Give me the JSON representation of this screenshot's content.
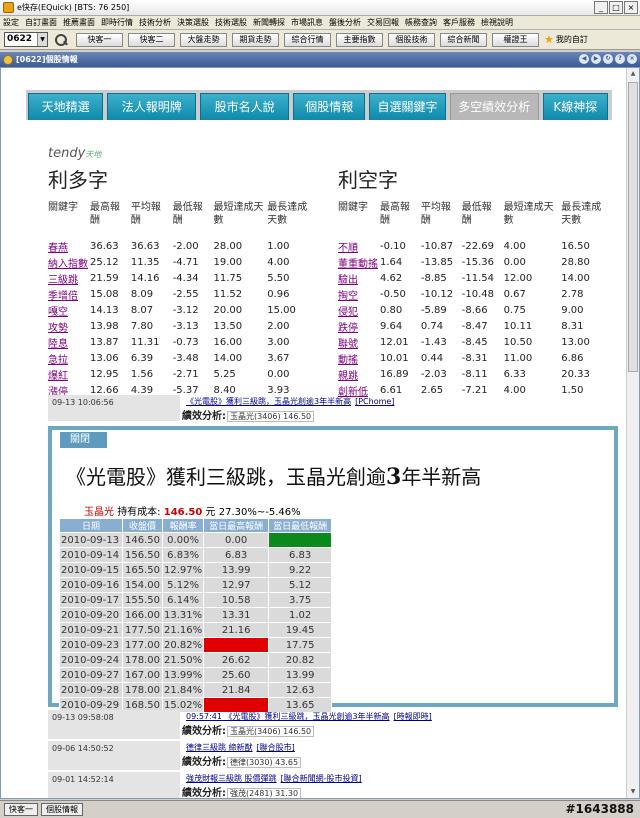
{
  "window": {
    "title": "e快存(EQuick)  [BTS: 76 250]"
  },
  "menu": [
    "設定",
    "自訂畫面",
    "推薦畫面",
    "即時行情",
    "技術分析",
    "決策選股",
    "技術選股",
    "新聞轉探",
    "市場訊息",
    "盤後分析",
    "交易回報",
    "帳務查詢",
    "客戶服務",
    "檢視說明"
  ],
  "toolbar": {
    "code": "0622",
    "buttons": [
      "快客一",
      "快客二",
      "大盤走勢",
      "期貨走勢",
      "綜合行情",
      "主要指數",
      "個股技術",
      "綜合新聞",
      "權證王"
    ],
    "favorite": "我的自訂"
  },
  "panel": {
    "title": "[0622]個股情報"
  },
  "tabs": [
    {
      "label": "天地精選",
      "active": false
    },
    {
      "label": "法人報明牌",
      "active": false
    },
    {
      "label": "股市名人說",
      "active": false
    },
    {
      "label": "個股情報",
      "active": false
    },
    {
      "label": "自選關鍵字",
      "active": false
    },
    {
      "label": "多空績效分析",
      "active": true
    },
    {
      "label": "K線神探",
      "active": false
    }
  ],
  "logo": {
    "brand": "tendy",
    "sub": "天地"
  },
  "bull": {
    "heading": "利多字",
    "headers": [
      "關鍵字",
      "最高報酬",
      "平均報酬",
      "最低報酬",
      "最短達成天數",
      "最長達成天數"
    ],
    "rows": [
      [
        "春燕",
        "36.63",
        "36.63",
        "-2.00",
        "28.00",
        "1.00"
      ],
      [
        "納入指數",
        "25.12",
        "11.35",
        "-4.71",
        "19.00",
        "4.00"
      ],
      [
        "三級跳",
        "21.59",
        "14.16",
        "-4.34",
        "11.75",
        "5.50"
      ],
      [
        "季增倍",
        "15.08",
        "8.09",
        "-2.55",
        "11.52",
        "0.96"
      ],
      [
        "嘎空",
        "14.13",
        "8.07",
        "-3.12",
        "20.00",
        "15.00"
      ],
      [
        "攻勢",
        "13.98",
        "7.80",
        "-3.13",
        "13.50",
        "2.00"
      ],
      [
        "陸息",
        "13.87",
        "11.31",
        "-0.73",
        "16.00",
        "3.00"
      ],
      [
        "急拉",
        "13.06",
        "6.39",
        "-3.48",
        "14.00",
        "3.67"
      ],
      [
        "爆紅",
        "12.95",
        "1.56",
        "-2.71",
        "5.25",
        "0.00"
      ],
      [
        "漲停",
        "12.66",
        "4.39",
        "-5.37",
        "8.40",
        "3.93"
      ]
    ]
  },
  "bear": {
    "heading": "利空字",
    "headers": [
      "關鍵字",
      "最高報酬",
      "平均報酬",
      "最低報酬",
      "最短達成天數",
      "最長達成天數"
    ],
    "rows": [
      [
        "不順",
        "-0.10",
        "-10.87",
        "-22.69",
        "4.00",
        "16.50"
      ],
      [
        "董重動搖",
        "1.64",
        "-13.85",
        "-15.36",
        "0.00",
        "28.80"
      ],
      [
        "驗出",
        "4.62",
        "-8.85",
        "-11.54",
        "12.00",
        "14.00"
      ],
      [
        "掏空",
        "-0.50",
        "-10.12",
        "-10.48",
        "0.67",
        "2.78"
      ],
      [
        "侵犯",
        "0.80",
        "-5.89",
        "-8.66",
        "0.75",
        "9.00"
      ],
      [
        "跌停",
        "9.64",
        "0.74",
        "-8.47",
        "10.11",
        "8.31"
      ],
      [
        "聯號",
        "12.01",
        "-1.43",
        "-8.45",
        "10.50",
        "13.00"
      ],
      [
        "動搖",
        "10.01",
        "0.44",
        "-8.31",
        "11.00",
        "6.86"
      ],
      [
        "親跳",
        "16.89",
        "-2.03",
        "-8.11",
        "6.33",
        "20.33"
      ],
      [
        "創新低",
        "6.61",
        "2.65",
        "-7.21",
        "4.00",
        "1.50"
      ]
    ]
  },
  "news": [
    {
      "date": "09-13 10:06:56",
      "title": "《光電股》獲利三級跳，玉晶光創逾3年半新高",
      "source": "[PChome]",
      "perf_label": "績效分析:",
      "stock": "玉晶光(3406) 146.50"
    },
    {
      "date": "09-13 09:58:08",
      "title": "09:57:41 《光電股》獲利三級跳，玉晶光創逾3年半新高",
      "source": "[時報即時]",
      "perf_label": "績效分析:",
      "stock": "玉晶光(3406) 146.50"
    },
    {
      "date": "09-06 14:50:52",
      "title": "德律三級跳 締新猷",
      "source": "[聯合股市]",
      "perf_label": "績效分析:",
      "stock": "德律(3030) 43.65"
    },
    {
      "date": "09-01 14:52:14",
      "title": "強茂財報三級跳 股價彈跳",
      "source": "[聯合新聞網-股市投資]",
      "perf_label": "績效分析:",
      "stock": "強茂(2481) 31.30"
    }
  ],
  "popup": {
    "close_label": "關閉",
    "title_pre": "《光電股》獲利三級跳，玉晶光創逾",
    "title_num": "3",
    "title_post": "年半新高",
    "stock_name": "玉晶光",
    "cost_label": "持有成本:",
    "cost_value": "146.50",
    "cost_unit": "元",
    "range": "27.30%~-5.46%",
    "headers": [
      "日期",
      "收盤價",
      "報酬率",
      "當日最高報酬",
      "當日最低報酬"
    ],
    "rows": [
      [
        "2010-09-13",
        "146.50",
        "0.00%",
        "0.00",
        ""
      ],
      [
        "2010-09-14",
        "156.50",
        "6.83%",
        "6.83",
        "6.83"
      ],
      [
        "2010-09-15",
        "165.50",
        "12.97%",
        "13.99",
        "9.22"
      ],
      [
        "2010-09-16",
        "154.00",
        "5.12%",
        "12.97",
        "5.12"
      ],
      [
        "2010-09-17",
        "155.50",
        "6.14%",
        "10.58",
        "3.75"
      ],
      [
        "2010-09-20",
        "166.00",
        "13.31%",
        "13.31",
        "1.02"
      ],
      [
        "2010-09-21",
        "177.50",
        "21.16%",
        "21.16",
        "19.45"
      ],
      [
        "2010-09-23",
        "177.00",
        "20.82%",
        "",
        "17.75"
      ],
      [
        "2010-09-24",
        "178.00",
        "21.50%",
        "26.62",
        "20.82"
      ],
      [
        "2010-09-27",
        "167.00",
        "13.99%",
        "25.60",
        "13.99"
      ],
      [
        "2010-09-28",
        "178.00",
        "21.84%",
        "21.84",
        "12.63"
      ],
      [
        "2010-09-29",
        "168.50",
        "15.02%",
        "",
        "13.65"
      ]
    ],
    "red_cells": [
      7,
      11
    ],
    "green_cells": [
      0
    ]
  },
  "statusbar": {
    "buttons": [
      "快客一",
      "個股情報"
    ],
    "id": "#1643888"
  }
}
